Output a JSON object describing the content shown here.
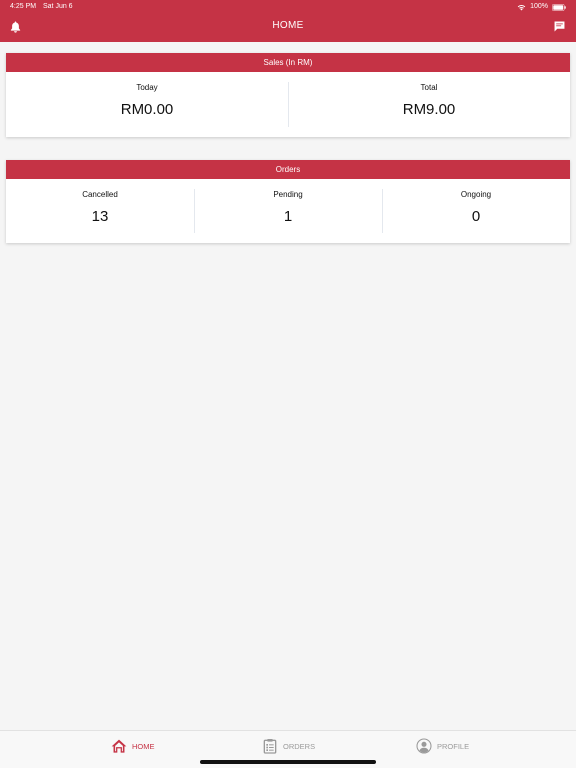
{
  "status_bar": {
    "time": "4:25 PM",
    "date": "Sat Jun 6",
    "battery": "100%"
  },
  "header": {
    "title": "HOME"
  },
  "colors": {
    "brand": "#c53345",
    "background": "#f5f5f5",
    "inactive": "#9a9a9a"
  },
  "sales": {
    "title": "Sales (In RM)",
    "stats": [
      {
        "label": "Today",
        "value": "RM0.00"
      },
      {
        "label": "Total",
        "value": "RM9.00"
      }
    ]
  },
  "orders": {
    "title": "Orders",
    "stats": [
      {
        "label": "Cancelled",
        "value": "13"
      },
      {
        "label": "Pending",
        "value": "1"
      },
      {
        "label": "Ongoing",
        "value": "0"
      }
    ]
  },
  "tabs": [
    {
      "label": "HOME",
      "icon": "home-icon",
      "active": true
    },
    {
      "label": "ORDERS",
      "icon": "clipboard-icon",
      "active": false
    },
    {
      "label": "PROFILE",
      "icon": "user-circle-icon",
      "active": false
    }
  ]
}
